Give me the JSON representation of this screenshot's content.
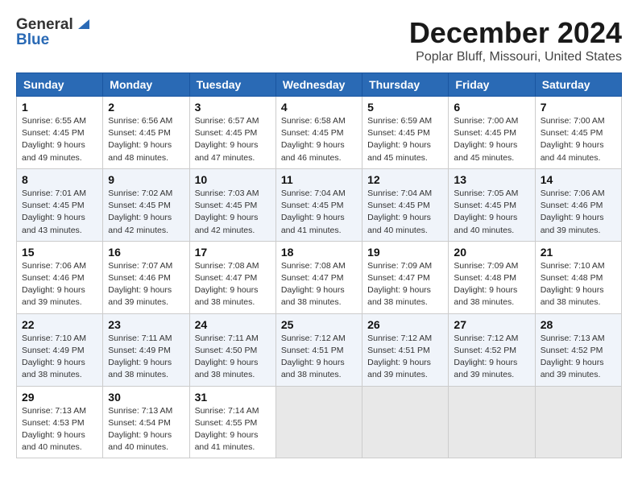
{
  "header": {
    "logo_general": "General",
    "logo_blue": "Blue",
    "title": "December 2024",
    "subtitle": "Poplar Bluff, Missouri, United States"
  },
  "days_of_week": [
    "Sunday",
    "Monday",
    "Tuesday",
    "Wednesday",
    "Thursday",
    "Friday",
    "Saturday"
  ],
  "weeks": [
    [
      {
        "day": "1",
        "sunrise": "6:55 AM",
        "sunset": "4:45 PM",
        "daylight": "9 hours and 49 minutes."
      },
      {
        "day": "2",
        "sunrise": "6:56 AM",
        "sunset": "4:45 PM",
        "daylight": "9 hours and 48 minutes."
      },
      {
        "day": "3",
        "sunrise": "6:57 AM",
        "sunset": "4:45 PM",
        "daylight": "9 hours and 47 minutes."
      },
      {
        "day": "4",
        "sunrise": "6:58 AM",
        "sunset": "4:45 PM",
        "daylight": "9 hours and 46 minutes."
      },
      {
        "day": "5",
        "sunrise": "6:59 AM",
        "sunset": "4:45 PM",
        "daylight": "9 hours and 45 minutes."
      },
      {
        "day": "6",
        "sunrise": "7:00 AM",
        "sunset": "4:45 PM",
        "daylight": "9 hours and 45 minutes."
      },
      {
        "day": "7",
        "sunrise": "7:00 AM",
        "sunset": "4:45 PM",
        "daylight": "9 hours and 44 minutes."
      }
    ],
    [
      {
        "day": "8",
        "sunrise": "7:01 AM",
        "sunset": "4:45 PM",
        "daylight": "9 hours and 43 minutes."
      },
      {
        "day": "9",
        "sunrise": "7:02 AM",
        "sunset": "4:45 PM",
        "daylight": "9 hours and 42 minutes."
      },
      {
        "day": "10",
        "sunrise": "7:03 AM",
        "sunset": "4:45 PM",
        "daylight": "9 hours and 42 minutes."
      },
      {
        "day": "11",
        "sunrise": "7:04 AM",
        "sunset": "4:45 PM",
        "daylight": "9 hours and 41 minutes."
      },
      {
        "day": "12",
        "sunrise": "7:04 AM",
        "sunset": "4:45 PM",
        "daylight": "9 hours and 40 minutes."
      },
      {
        "day": "13",
        "sunrise": "7:05 AM",
        "sunset": "4:45 PM",
        "daylight": "9 hours and 40 minutes."
      },
      {
        "day": "14",
        "sunrise": "7:06 AM",
        "sunset": "4:46 PM",
        "daylight": "9 hours and 39 minutes."
      }
    ],
    [
      {
        "day": "15",
        "sunrise": "7:06 AM",
        "sunset": "4:46 PM",
        "daylight": "9 hours and 39 minutes."
      },
      {
        "day": "16",
        "sunrise": "7:07 AM",
        "sunset": "4:46 PM",
        "daylight": "9 hours and 39 minutes."
      },
      {
        "day": "17",
        "sunrise": "7:08 AM",
        "sunset": "4:47 PM",
        "daylight": "9 hours and 38 minutes."
      },
      {
        "day": "18",
        "sunrise": "7:08 AM",
        "sunset": "4:47 PM",
        "daylight": "9 hours and 38 minutes."
      },
      {
        "day": "19",
        "sunrise": "7:09 AM",
        "sunset": "4:47 PM",
        "daylight": "9 hours and 38 minutes."
      },
      {
        "day": "20",
        "sunrise": "7:09 AM",
        "sunset": "4:48 PM",
        "daylight": "9 hours and 38 minutes."
      },
      {
        "day": "21",
        "sunrise": "7:10 AM",
        "sunset": "4:48 PM",
        "daylight": "9 hours and 38 minutes."
      }
    ],
    [
      {
        "day": "22",
        "sunrise": "7:10 AM",
        "sunset": "4:49 PM",
        "daylight": "9 hours and 38 minutes."
      },
      {
        "day": "23",
        "sunrise": "7:11 AM",
        "sunset": "4:49 PM",
        "daylight": "9 hours and 38 minutes."
      },
      {
        "day": "24",
        "sunrise": "7:11 AM",
        "sunset": "4:50 PM",
        "daylight": "9 hours and 38 minutes."
      },
      {
        "day": "25",
        "sunrise": "7:12 AM",
        "sunset": "4:51 PM",
        "daylight": "9 hours and 38 minutes."
      },
      {
        "day": "26",
        "sunrise": "7:12 AM",
        "sunset": "4:51 PM",
        "daylight": "9 hours and 39 minutes."
      },
      {
        "day": "27",
        "sunrise": "7:12 AM",
        "sunset": "4:52 PM",
        "daylight": "9 hours and 39 minutes."
      },
      {
        "day": "28",
        "sunrise": "7:13 AM",
        "sunset": "4:52 PM",
        "daylight": "9 hours and 39 minutes."
      }
    ],
    [
      {
        "day": "29",
        "sunrise": "7:13 AM",
        "sunset": "4:53 PM",
        "daylight": "9 hours and 40 minutes."
      },
      {
        "day": "30",
        "sunrise": "7:13 AM",
        "sunset": "4:54 PM",
        "daylight": "9 hours and 40 minutes."
      },
      {
        "day": "31",
        "sunrise": "7:14 AM",
        "sunset": "4:55 PM",
        "daylight": "9 hours and 41 minutes."
      },
      null,
      null,
      null,
      null
    ]
  ]
}
